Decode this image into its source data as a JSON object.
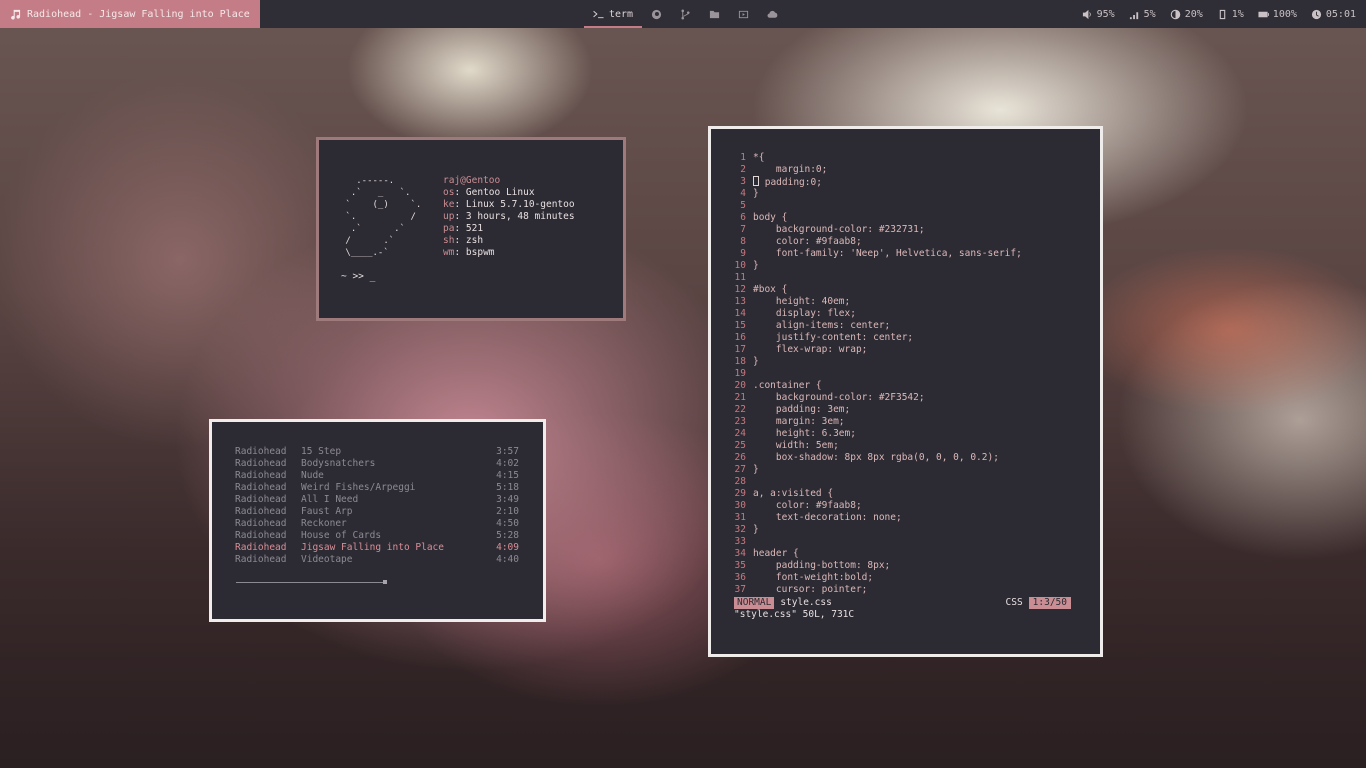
{
  "topbar": {
    "now_playing": "Radiohead - Jigsaw Falling into Place",
    "workspaces": [
      {
        "label": "term",
        "icon": "terminal-icon",
        "active": true
      },
      {
        "label": "",
        "icon": "firefox-icon",
        "active": false
      },
      {
        "label": "",
        "icon": "git-branch-icon",
        "active": false
      },
      {
        "label": "",
        "icon": "folder-icon",
        "active": false
      },
      {
        "label": "",
        "icon": "media-icon",
        "active": false
      },
      {
        "label": "",
        "icon": "cloud-icon",
        "active": false
      }
    ],
    "status": {
      "volume": "95%",
      "network": "5%",
      "brightness": "20%",
      "memory": "1%",
      "battery": "100%",
      "clock": "05:01"
    }
  },
  "fetch": {
    "ascii_art": "   .-----.\n  .`   _   `.\n `    (_)    `.\n `.          /\n  .`      .`\n /      .`\n \\____.-`",
    "rows": [
      {
        "key": "raj@Gentoo",
        "value": ""
      },
      {
        "key": "os",
        "value": "Gentoo Linux"
      },
      {
        "key": "ke",
        "value": "Linux 5.7.10-gentoo"
      },
      {
        "key": "up",
        "value": "3 hours, 48 minutes"
      },
      {
        "key": "pa",
        "value": "521"
      },
      {
        "key": "sh",
        "value": "zsh"
      },
      {
        "key": "wm",
        "value": "bspwm"
      }
    ],
    "prompt": "~ >> _"
  },
  "playlist": {
    "tracks": [
      {
        "artist": "Radiohead",
        "title": "15 Step",
        "length": "3:57",
        "current": false
      },
      {
        "artist": "Radiohead",
        "title": "Bodysnatchers",
        "length": "4:02",
        "current": false
      },
      {
        "artist": "Radiohead",
        "title": "Nude",
        "length": "4:15",
        "current": false
      },
      {
        "artist": "Radiohead",
        "title": "Weird Fishes/Arpeggi",
        "length": "5:18",
        "current": false
      },
      {
        "artist": "Radiohead",
        "title": "All I Need",
        "length": "3:49",
        "current": false
      },
      {
        "artist": "Radiohead",
        "title": "Faust Arp",
        "length": "2:10",
        "current": false
      },
      {
        "artist": "Radiohead",
        "title": "Reckoner",
        "length": "4:50",
        "current": false
      },
      {
        "artist": "Radiohead",
        "title": "House of Cards",
        "length": "5:28",
        "current": false
      },
      {
        "artist": "Radiohead",
        "title": "Jigsaw Falling into Place",
        "length": "4:09",
        "current": true
      },
      {
        "artist": "Radiohead",
        "title": "Videotape",
        "length": "4:40",
        "current": false
      }
    ]
  },
  "editor": {
    "lines": [
      "*{",
      "    margin:0;",
      "[] padding:0;",
      "}",
      "",
      "body {",
      "    background-color: #232731;",
      "    color: #9faab8;",
      "    font-family: 'Neep', Helvetica, sans-serif;",
      "}",
      "",
      "#box {",
      "    height: 40em;",
      "    display: flex;",
      "    align-items: center;",
      "    justify-content: center;",
      "    flex-wrap: wrap;",
      "}",
      "",
      ".container {",
      "    background-color: #2F3542;",
      "    padding: 3em;",
      "    margin: 3em;",
      "    height: 6.3em;",
      "    width: 5em;",
      "    box-shadow: 8px 8px rgba(0, 0, 0, 0.2);",
      "}",
      "",
      "a, a:visited {",
      "    color: #9faab8;",
      "    text-decoration: none;",
      "}",
      "",
      "header {",
      "    padding-bottom: 8px;",
      "    font-weight:bold;",
      "    cursor: pointer;"
    ],
    "mode": "NORMAL",
    "filename": "style.css",
    "filetype": "CSS",
    "position": "1:3/50",
    "message": "\"style.css\" 50L, 731C"
  }
}
